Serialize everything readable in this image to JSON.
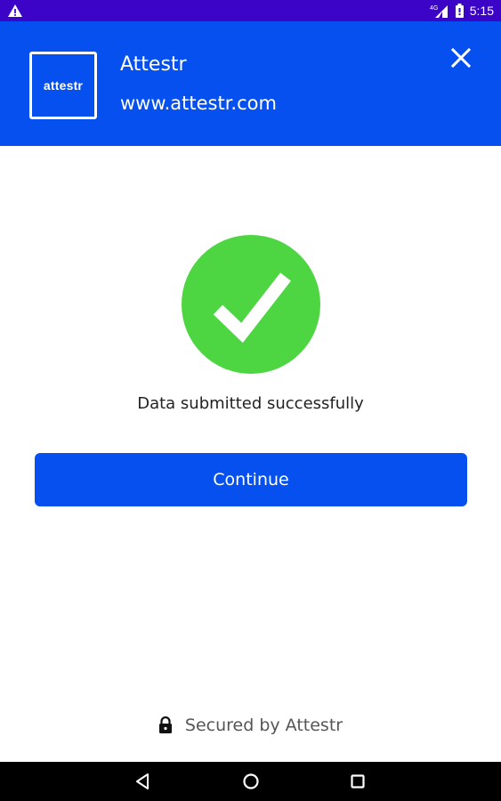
{
  "status_bar": {
    "network": "4G",
    "time": "5:15",
    "icons": [
      "warning-icon",
      "signal-icon",
      "battery-icon"
    ]
  },
  "header": {
    "logo_text": "attestr",
    "title": "Attestr",
    "url": "www.attestr.com",
    "close_icon": "close-icon"
  },
  "main": {
    "success_icon": "check-circle-icon",
    "message": "Data submitted successfully",
    "continue_label": "Continue"
  },
  "footer": {
    "lock_icon": "lock-icon",
    "secured_text": "Secured by Attestr"
  },
  "nav": {
    "icons": [
      "back-icon",
      "home-icon",
      "recents-icon"
    ]
  },
  "colors": {
    "status_bar": "#3c04c6",
    "primary": "#0650ef",
    "success": "#4dd542",
    "text": "#222222",
    "muted": "#555555"
  }
}
